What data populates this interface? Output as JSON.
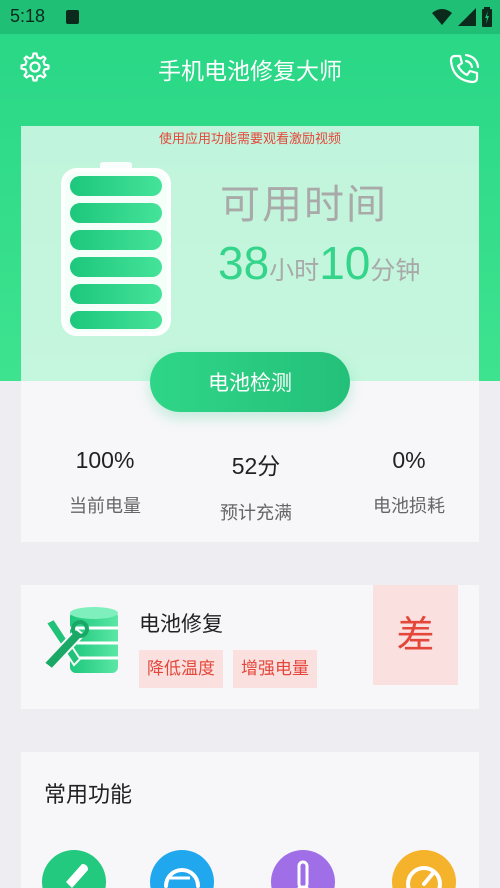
{
  "status": {
    "time": "5:18"
  },
  "header": {
    "title": "手机电池修复大师",
    "settings_icon": "gear-icon",
    "phone_icon": "phone-icon"
  },
  "hero": {
    "ad_text": "使用应用功能需要观看激励视频",
    "available_label": "可用时间",
    "hours": "38",
    "hours_unit": "小时",
    "minutes": "10",
    "minutes_unit": "分钟",
    "battery_icon": "battery-icon"
  },
  "check_button": "电池检测",
  "stats": [
    {
      "value": "100%",
      "label": "当前电量"
    },
    {
      "value": "52分",
      "label": "预计充满"
    },
    {
      "value": "0%",
      "label": "电池损耗"
    }
  ],
  "repair": {
    "title": "电池修复",
    "tags": [
      "降低温度",
      "增强电量"
    ],
    "grade": "差",
    "icon": "battery-repair-icon"
  },
  "functions": {
    "title": "常用功能",
    "items": [
      {
        "icon": "rocket-icon",
        "color": "#22c97e"
      },
      {
        "icon": "gauge-icon",
        "color": "#21a7ee"
      },
      {
        "icon": "thermometer-icon",
        "color": "#a06fe8"
      },
      {
        "icon": "speed-icon",
        "color": "#f4b32a"
      }
    ]
  },
  "colors": {
    "accent": "#2ad185",
    "warning": "#e4473a",
    "time_green": "#34d48a"
  }
}
